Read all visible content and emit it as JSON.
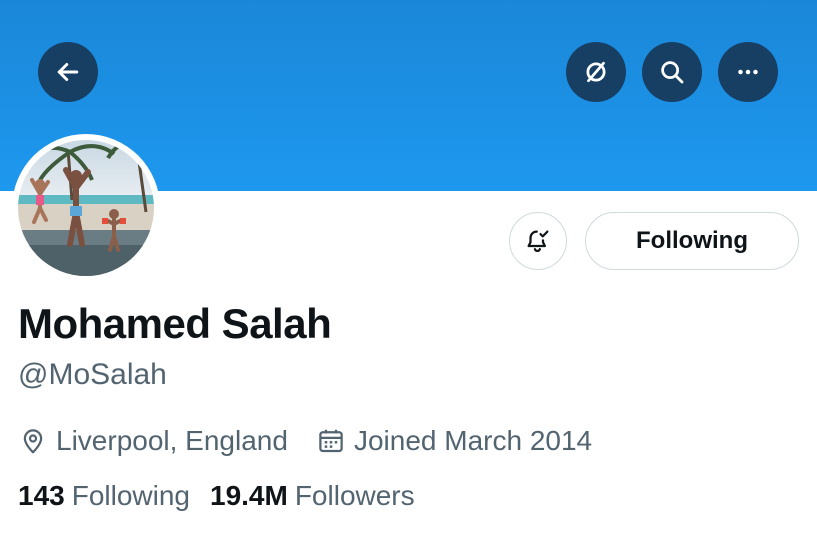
{
  "profile": {
    "name": "Mohamed Salah",
    "handle": "@MoSalah",
    "location": "Liverpool, England",
    "joined": "Joined March 2014",
    "follow_button_label": "Following"
  },
  "stats": {
    "following_count": "143",
    "following_label": "Following",
    "followers_count": "19.4M",
    "followers_label": "Followers"
  },
  "icons": {
    "back": "arrow-left-icon",
    "translate": "translate-off-icon",
    "search": "search-icon",
    "more": "more-horizontal-icon",
    "notifications": "bell-check-icon",
    "location": "location-pin-icon",
    "calendar": "calendar-icon"
  },
  "colors": {
    "banner": "#1d98ee",
    "header_button_bg": "#173f63",
    "text_primary": "#0f1419",
    "text_secondary": "#536471",
    "border": "#cfd9de"
  }
}
